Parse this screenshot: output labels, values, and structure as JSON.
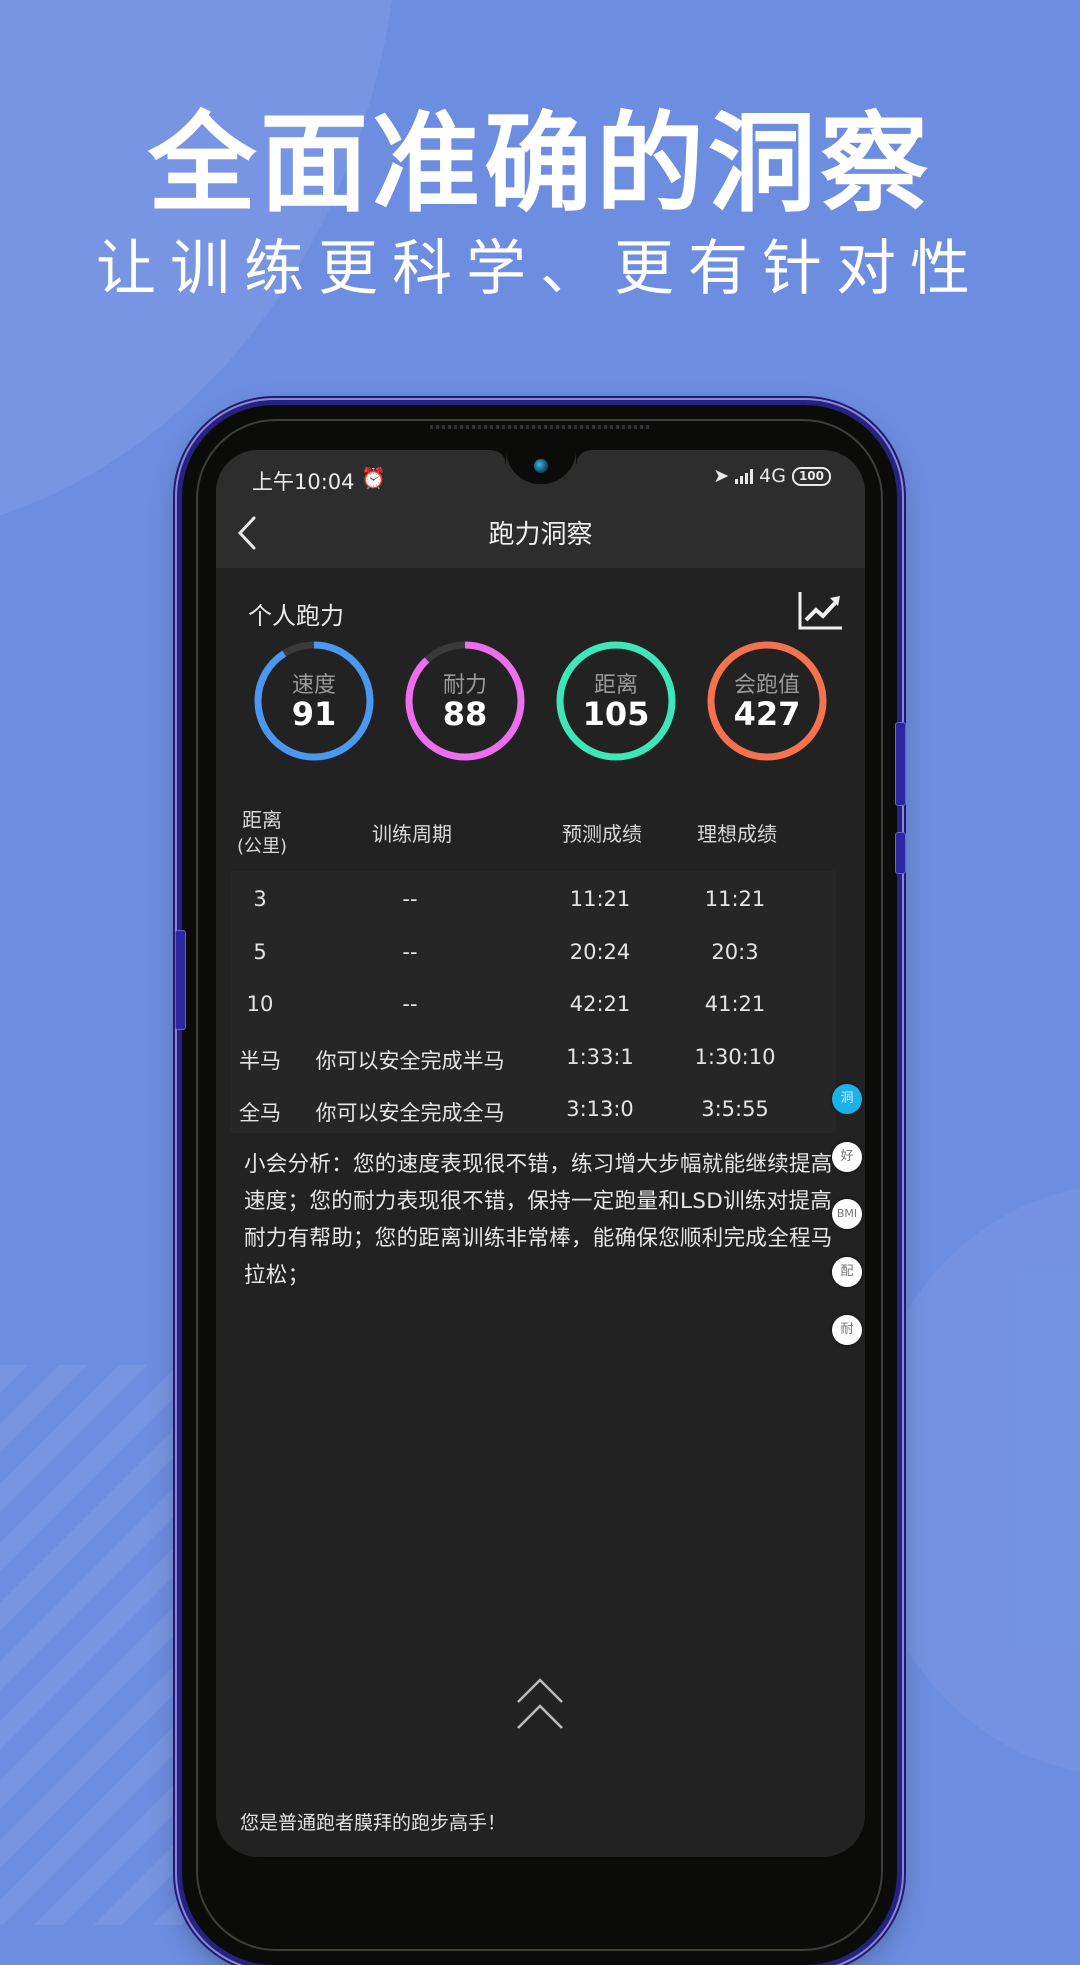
{
  "promo": {
    "headline": "全面准确的洞察",
    "subheadline": "让训练更科学、更有针对性"
  },
  "status_bar": {
    "time": "上午10:04",
    "alarm_icon": "alarm-clock-icon",
    "network": "4G",
    "battery": "100"
  },
  "nav": {
    "back_icon": "chevron-left-icon",
    "title": "跑力洞察"
  },
  "section": {
    "title": "个人跑力",
    "trend_icon": "trend-chart-icon"
  },
  "rings": [
    {
      "label": "速度",
      "value": "91",
      "progress": 0.91,
      "color": "#4a98f0"
    },
    {
      "label": "耐力",
      "value": "88",
      "progress": 0.88,
      "color": "#ee6ef0"
    },
    {
      "label": "距离",
      "value": "105",
      "progress": 1.0,
      "color": "#3ee8b6"
    },
    {
      "label": "会跑值",
      "value": "427",
      "progress": 1.0,
      "color": "#f4724e"
    }
  ],
  "table": {
    "headers": {
      "distance": "距离",
      "distance_unit": "(公里)",
      "cycle": "训练周期",
      "predicted": "预测成绩",
      "ideal": "理想成绩"
    },
    "rows": [
      {
        "distance": "3",
        "cycle": "--",
        "predicted": "11:21",
        "ideal": "11:21"
      },
      {
        "distance": "5",
        "cycle": "--",
        "predicted": "20:24",
        "ideal": "20:3"
      },
      {
        "distance": "10",
        "cycle": "--",
        "predicted": "42:21",
        "ideal": "41:21"
      },
      {
        "distance": "半马",
        "cycle": "你可以安全完成半马",
        "predicted": "1:33:1",
        "ideal": "1:30:10"
      },
      {
        "distance": "全马",
        "cycle": "你可以安全完成全马",
        "predicted": "3:13:0",
        "ideal": "3:5:55"
      }
    ]
  },
  "analysis": "小会分析：您的速度表现很不错，练习增大步幅就能继续提高速度；您的耐力表现很不错，保持一定跑量和LSD训练对提高耐力有帮助；您的距离训练非常棒，能确保您顺利完成全程马拉松；",
  "side_tabs": [
    {
      "label": "洞",
      "active": true
    },
    {
      "label": "好",
      "active": false
    },
    {
      "label": "BMI",
      "active": false
    },
    {
      "label": "配",
      "active": false
    },
    {
      "label": "耐",
      "active": false
    }
  ],
  "scroll_up_icon": "double-chevron-up-icon",
  "footer": "您是普通跑者膜拜的跑步高手！"
}
